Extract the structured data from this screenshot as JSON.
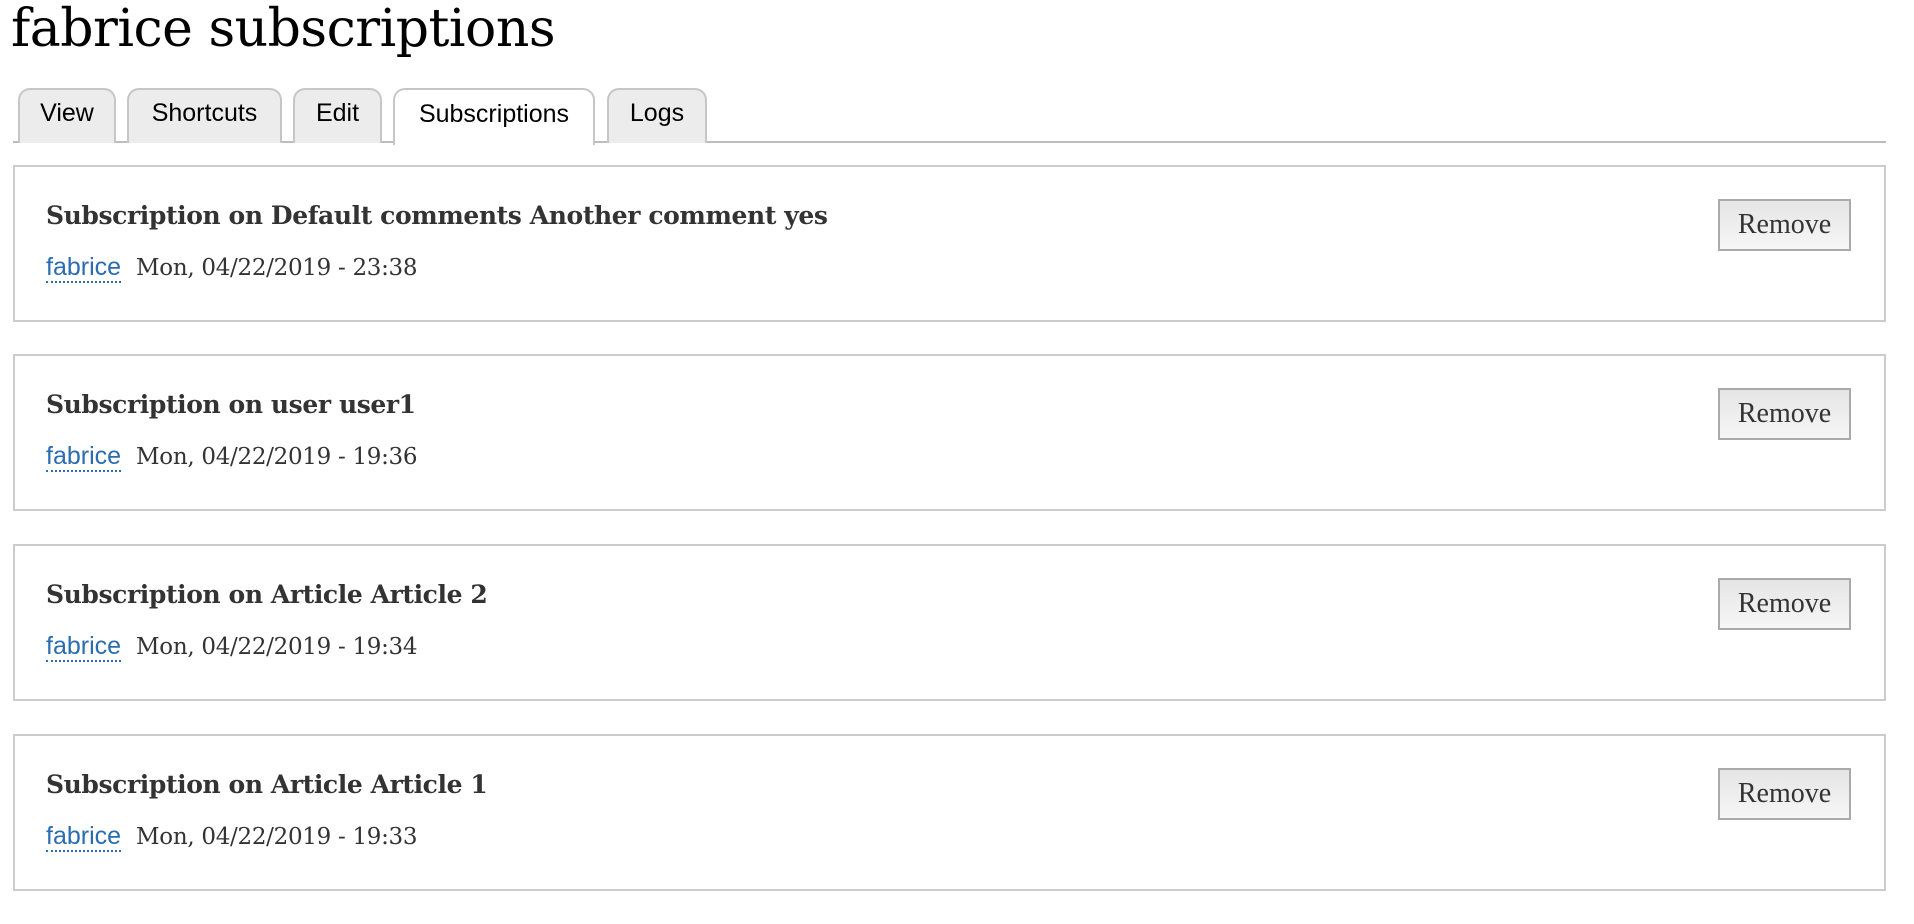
{
  "page": {
    "title": "fabrice subscriptions"
  },
  "tabs": [
    {
      "label": "View",
      "active": false
    },
    {
      "label": "Shortcuts",
      "active": false
    },
    {
      "label": "Edit",
      "active": false
    },
    {
      "label": "Subscriptions",
      "active": true
    },
    {
      "label": "Logs",
      "active": false
    }
  ],
  "subscriptions": [
    {
      "title": "Subscription on Default comments Another comment yes",
      "author": "fabrice",
      "date": "Mon, 04/22/2019 - 23:38",
      "remove_label": "Remove"
    },
    {
      "title": "Subscription on user user1",
      "author": "fabrice",
      "date": "Mon, 04/22/2019 - 19:36",
      "remove_label": "Remove"
    },
    {
      "title": "Subscription on Article Article 2",
      "author": "fabrice",
      "date": "Mon, 04/22/2019 - 19:34",
      "remove_label": "Remove"
    },
    {
      "title": "Subscription on Article Article 1",
      "author": "fabrice",
      "date": "Mon, 04/22/2019 - 19:33",
      "remove_label": "Remove"
    }
  ],
  "colors": {
    "link": "#2a6db0",
    "card_border": "#cccccc",
    "text": "#333333"
  }
}
